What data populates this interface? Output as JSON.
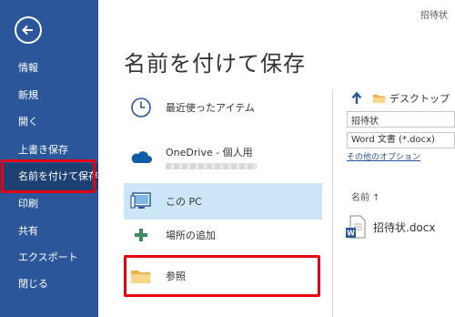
{
  "window": {
    "doc_title": "招待状"
  },
  "sidebar": {
    "back_icon": "back-arrow-icon",
    "items": [
      {
        "label": "情報"
      },
      {
        "label": "新規"
      },
      {
        "label": "開く"
      },
      {
        "label": "上書き保存"
      },
      {
        "label": "名前を付けて保存",
        "selected": true
      },
      {
        "label": "印刷"
      },
      {
        "label": "共有"
      },
      {
        "label": "エクスポート"
      },
      {
        "label": "閉じる"
      }
    ]
  },
  "main": {
    "title": "名前を付けて保存",
    "locations": [
      {
        "label": "最近使ったアイテム",
        "icon": "clock-icon"
      },
      {
        "label": "OneDrive - 個人用",
        "icon": "cloud-icon"
      },
      {
        "label": "この PC",
        "icon": "computer-icon",
        "selected": true
      },
      {
        "label": "場所の追加",
        "icon": "plus-icon"
      },
      {
        "label": "参照",
        "icon": "folder-icon"
      }
    ]
  },
  "pane": {
    "current_folder": "デスクトップ",
    "filename": "招待状",
    "filetype": "Word 文書 (*.docx)",
    "more_options": "その他のオプション",
    "column_name": "名前 ↑",
    "files": [
      {
        "name": "招待状.docx",
        "icon": "word-doc-icon"
      }
    ]
  },
  "colors": {
    "sidebar": "#2b579a",
    "sidebar_selected": "#1e4173",
    "selection": "#cde6f7",
    "highlight_red": "#e60012",
    "folder": "#f2c86b"
  }
}
